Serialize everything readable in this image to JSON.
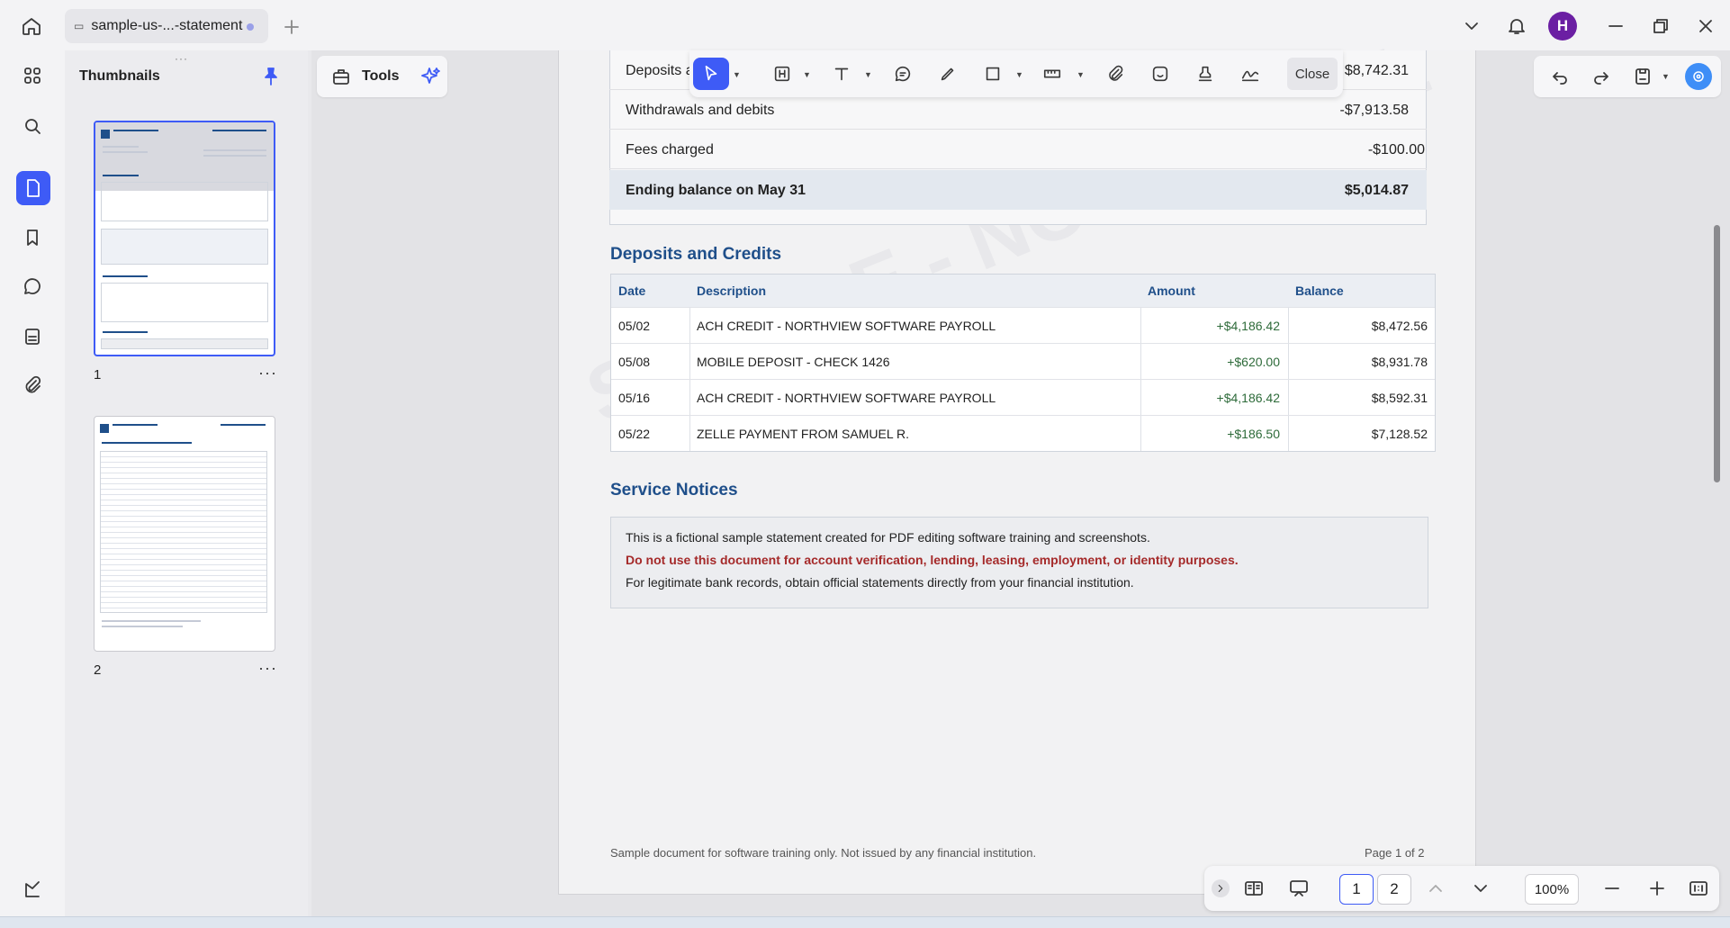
{
  "window": {
    "tab_title": "sample-us-...-statement",
    "avatar_initial": "H"
  },
  "thumbnails": {
    "title": "Thumbnails",
    "pages": [
      {
        "number": "1",
        "more": "···"
      },
      {
        "number": "2",
        "more": "···"
      }
    ]
  },
  "toolbar": {
    "tools_label": "Tools",
    "close_label": "Close"
  },
  "document": {
    "summary_rows": [
      {
        "label": "Deposits a",
        "value": "$8,742.31"
      },
      {
        "label": "Withdrawals and debits",
        "value": "-$7,913.58"
      },
      {
        "label": "Fees charged",
        "value": "-$100.00"
      },
      {
        "label": "Ending balance on May 31",
        "value": "$5,014.87"
      }
    ],
    "deposits_title": "Deposits and Credits",
    "deposits_columns": [
      "Date",
      "Description",
      "Amount",
      "Balance"
    ],
    "deposits_rows": [
      [
        "05/02",
        "ACH CREDIT - NORTHVIEW SOFTWARE PAYROLL",
        "+$4,186.42",
        "$8,472.56"
      ],
      [
        "05/08",
        "MOBILE DEPOSIT - CHECK 1426",
        "+$620.00",
        "$8,931.78"
      ],
      [
        "05/16",
        "ACH CREDIT - NORTHVIEW SOFTWARE PAYROLL",
        "+$4,186.42",
        "$8,592.31"
      ],
      [
        "05/22",
        "ZELLE PAYMENT FROM SAMUEL R.",
        "+$186.50",
        "$7,128.52"
      ]
    ],
    "notices_title": "Service Notices",
    "notice_line1": "This is a fictional sample statement created for PDF editing software training and screenshots.",
    "notice_line2": "Do not use this document for account verification, lending, leasing, employment, or identity purposes.",
    "notice_line3": "For legitimate bank records, obtain official statements directly from your financial institution.",
    "footer_left": "Sample document for software training only. Not issued by any financial institution.",
    "footer_right": "Page 1 of 2"
  },
  "page_nav": {
    "page1": "1",
    "page2": "2",
    "zoom": "100%"
  },
  "colors": {
    "accent": "#3e5bf6",
    "heading_blue": "#1f4f8a",
    "warning_red": "#a52a2a",
    "credit_green": "#2e6b3a"
  }
}
